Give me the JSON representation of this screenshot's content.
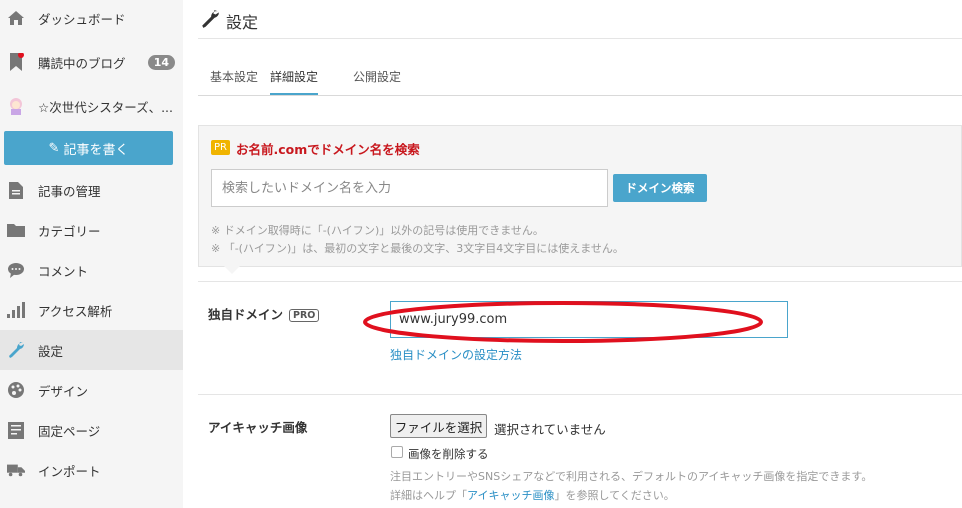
{
  "sidebar": {
    "items": [
      {
        "label": "ダッシュボード",
        "icon": "home-icon",
        "top": 0
      },
      {
        "label": "購読中のブログ",
        "icon": "bookmark-icon",
        "badge": "14"
      },
      {
        "label": "☆次世代シスターズ、..."
      },
      {
        "label": "記事の管理",
        "icon": "document-icon"
      },
      {
        "label": "カテゴリー",
        "icon": "folder-icon"
      },
      {
        "label": "コメント",
        "icon": "comment-icon"
      },
      {
        "label": "アクセス解析",
        "icon": "bar-chart-icon"
      },
      {
        "label": "設定",
        "icon": "wrench-icon",
        "active": true
      },
      {
        "label": "デザイン",
        "icon": "palette-icon"
      },
      {
        "label": "固定ページ",
        "icon": "page-icon"
      },
      {
        "label": "インポート",
        "icon": "truck-icon"
      }
    ],
    "write_button": "記事を書く"
  },
  "page": {
    "title": "設定",
    "tabs": [
      "基本設定",
      "詳細設定",
      "公開設定"
    ],
    "active_tab": "詳細設定"
  },
  "pr": {
    "tag": "PR",
    "title": "お名前.comでドメイン名を検索",
    "placeholder": "検索したいドメイン名を入力",
    "button": "ドメイン検索",
    "note1": "※ ドメイン取得時に「-(ハイフン)」以外の記号は使用できません。",
    "note2": "※ 「-(ハイフン)」は、最初の文字と最後の文字、3文字目4文字目には使えません。"
  },
  "custom_domain": {
    "label": "独自ドメイン",
    "pro": "PRO",
    "value": "www.jury99.com",
    "help_link": "独自ドメインの設定方法"
  },
  "eyecatch": {
    "label": "アイキャッチ画像",
    "file_button": "ファイルを選択",
    "file_status": "選択されていません",
    "delete_label": "画像を削除する",
    "help1": "注目エントリーやSNSシェアなどで利用される、デフォルトのアイキャッチ画像を指定できます。",
    "help2_pre": "詳細はヘルプ「",
    "help2_link": "アイキャッチ画像",
    "help2_post": "」を参照してください。"
  },
  "colors": {
    "accent": "#4aa5cc",
    "pr_red": "#c8181e",
    "annotation": "#e0101e"
  }
}
